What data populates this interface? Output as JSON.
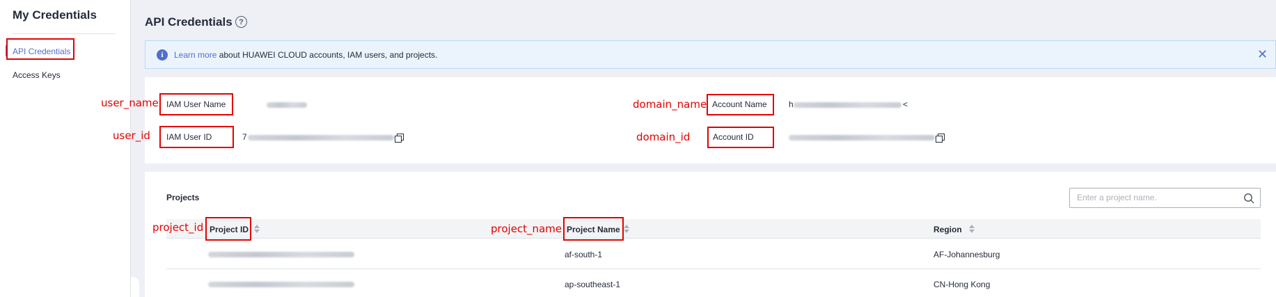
{
  "sidebar": {
    "title": "My Credentials",
    "items": [
      {
        "label": "API Credentials",
        "active": true
      },
      {
        "label": "Access Keys",
        "active": false
      }
    ]
  },
  "page": {
    "title": "API Credentials",
    "help_icon": "question-circle-icon"
  },
  "banner": {
    "link_text": "Learn more",
    "text": " about HUAWEI CLOUD accounts, IAM users, and projects.",
    "info_icon": "info-circle-icon",
    "close_icon": "close-icon"
  },
  "credentials": {
    "iam_user_name_label": "IAM User Name",
    "iam_user_id_label": "IAM User ID",
    "iam_user_id_prefix": "7",
    "account_name_label": "Account Name",
    "account_name_prefix": "h",
    "account_name_suffix": "<",
    "account_id_label": "Account ID"
  },
  "annotations": {
    "user_name": "user_name",
    "user_id": "user_id",
    "domain_name": "domain_name",
    "domain_id": "domain_id",
    "project_id": "project_id",
    "project_name": "project_name"
  },
  "projects": {
    "title": "Projects",
    "search_placeholder": "Enter a project name.",
    "columns": [
      "Project ID",
      "Project Name",
      "Region"
    ],
    "rows": [
      {
        "project_name": "af-south-1",
        "region": "AF-Johannesburg"
      },
      {
        "project_name": "ap-southeast-1",
        "region": "CN-Hong Kong"
      }
    ]
  },
  "colors": {
    "accent": "#526ecc",
    "annotation_red": "#e30000",
    "banner_bg": "#ebf4fd"
  }
}
